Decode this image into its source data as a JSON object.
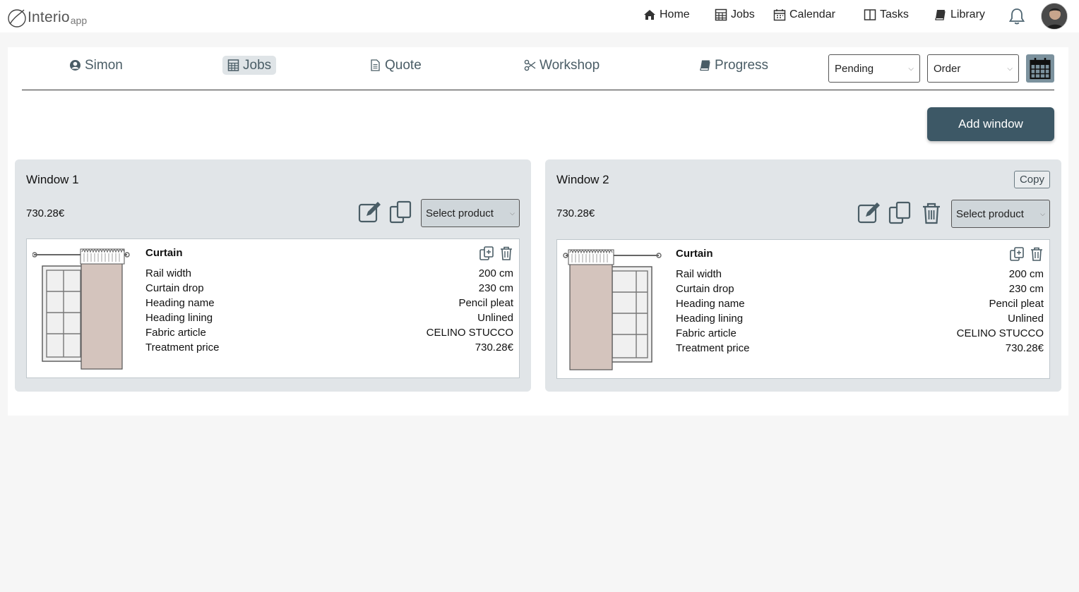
{
  "app": {
    "logo_text": "Interio",
    "logo_sub": "app"
  },
  "nav": [
    {
      "label": "Home",
      "icon": "home-icon"
    },
    {
      "label": "Jobs",
      "icon": "calculator-icon"
    },
    {
      "label": "Calendar",
      "icon": "calendar-icon"
    },
    {
      "label": "Tasks",
      "icon": "columns-icon"
    },
    {
      "label": "Library",
      "icon": "book-icon"
    }
  ],
  "tabs": [
    {
      "label": "Simon",
      "icon": "user-circle-icon",
      "active": false
    },
    {
      "label": "Jobs",
      "icon": "calculator-icon",
      "active": true
    },
    {
      "label": "Quote",
      "icon": "document-icon",
      "active": false
    },
    {
      "label": "Workshop",
      "icon": "scissors-icon",
      "active": false
    },
    {
      "label": "Progress",
      "icon": "book-icon",
      "active": false
    }
  ],
  "filters": {
    "status": "Pending",
    "type": "Order"
  },
  "add_window_label": "Add window",
  "windows": [
    {
      "title": "Window 1",
      "price": "730.28€",
      "show_copy": false,
      "copy_label": "",
      "product_select": "Select product",
      "item": {
        "name": "Curtain",
        "rows": [
          {
            "label": "Rail width",
            "value": "200 cm"
          },
          {
            "label": "Curtain drop",
            "value": "230 cm"
          },
          {
            "label": "Heading name",
            "value": "Pencil pleat"
          },
          {
            "label": "Heading lining",
            "value": "Unlined"
          },
          {
            "label": "Fabric article",
            "value": "CELINO STUCCO"
          },
          {
            "label": "Treatment price",
            "value": "730.28€"
          }
        ]
      }
    },
    {
      "title": "Window 2",
      "price": "730.28€",
      "show_copy": true,
      "copy_label": "Copy",
      "product_select": "Select product",
      "item": {
        "name": "Curtain",
        "rows": [
          {
            "label": "Rail width",
            "value": "200 cm"
          },
          {
            "label": "Curtain drop",
            "value": "230 cm"
          },
          {
            "label": "Heading name",
            "value": "Pencil pleat"
          },
          {
            "label": "Heading lining",
            "value": "Unlined"
          },
          {
            "label": "Fabric article",
            "value": "CELINO STUCCO"
          },
          {
            "label": "Treatment price",
            "value": "730.28€"
          }
        ]
      }
    }
  ],
  "colors": {
    "accent": "#3d5866",
    "panel": "#e1e5e8",
    "tab_active": "#dfe4e7",
    "curtain": "#d4c4bd"
  }
}
